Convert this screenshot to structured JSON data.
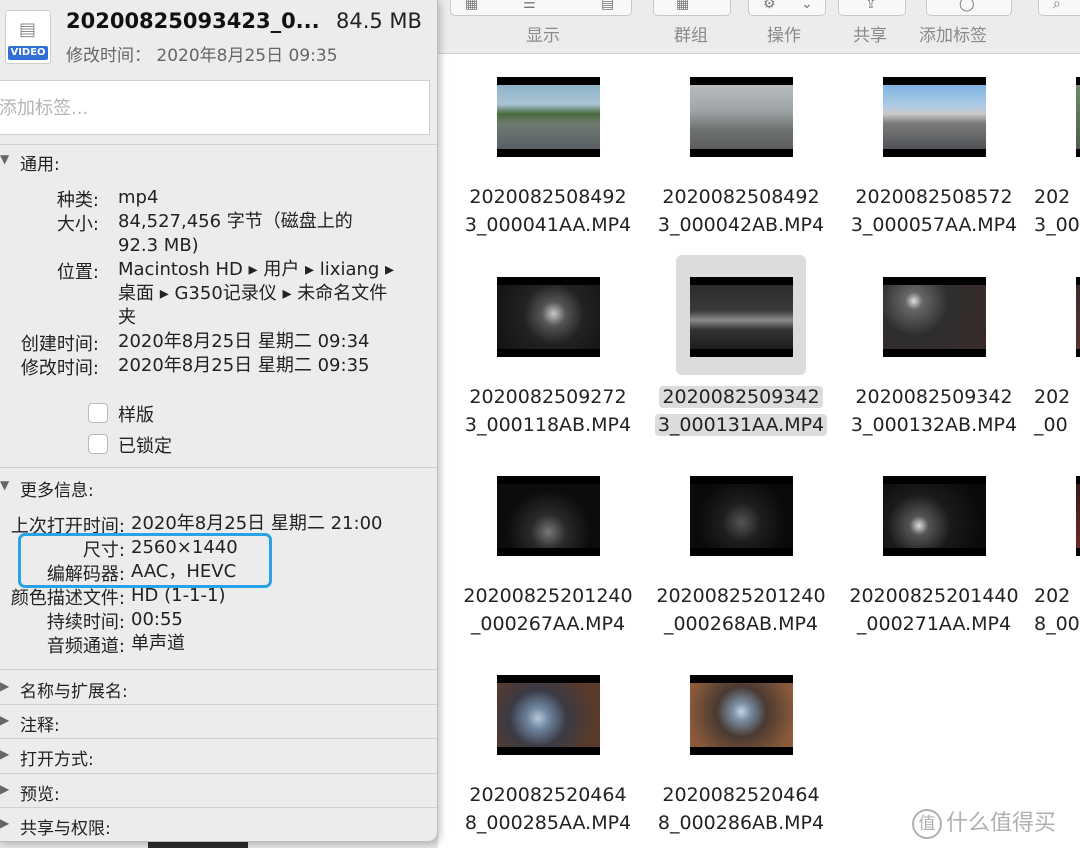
{
  "info_panel": {
    "file_icon_tag": "VIDEO",
    "title": "20200825093423_0...",
    "size": "84.5 MB",
    "modified": "修改时间： 2020年8月25日 09:35",
    "tags_placeholder": "添加标签...",
    "general": {
      "header": "通用:",
      "kind_label": "种类:",
      "kind": "mp4",
      "size_label": "大小:",
      "size_line1": "84,527,456 字节（磁盘上的",
      "size_line2": "92.3 MB)",
      "where_label": "位置:",
      "where_line1": "Macintosh HD ▸ 用户 ▸ lixiang ▸",
      "where_line2": "桌面 ▸ G350记录仪 ▸ 未命名文件",
      "where_line3": "夹",
      "created_label": "创建时间:",
      "created": "2020年8月25日 星期二 09:34",
      "modified_label": "修改时间:",
      "modified": "2020年8月25日 星期二 09:35",
      "stationery_label": "样版",
      "locked_label": "已锁定"
    },
    "more_info": {
      "header": "更多信息:",
      "last_opened_label": "上次打开时间:",
      "last_opened": "2020年8月25日 星期二 21:00",
      "dimensions_label": "尺寸:",
      "dimensions": "2560×1440",
      "codecs_label": "编解码器:",
      "codecs": "AAC，HEVC",
      "color_profile_label": "颜色描述文件:",
      "color_profile": "HD (1-1-1)",
      "duration_label": "持续时间:",
      "duration": "00:55",
      "audio_channels_label": "音频通道:",
      "audio_channels": "单声道"
    },
    "collapsed_sections": [
      "名称与扩展名:",
      "注释:",
      "打开方式:",
      "预览:",
      "共享与权限:"
    ]
  },
  "toolbar": {
    "view_label": "显示",
    "group_label": "群组",
    "action_label": "操作",
    "share_label": "共享",
    "tags_label": "添加标签"
  },
  "files": [
    {
      "line1": "2020082508492",
      "line2": "3_000041AA.MP4",
      "selected": false
    },
    {
      "line1": "2020082508492",
      "line2": "3_000042AB.MP4",
      "selected": false
    },
    {
      "line1": "2020082508572",
      "line2": "3_000057AA.MP4",
      "selected": false
    },
    {
      "line1": "202",
      "line2": "3_00",
      "selected": false
    },
    {
      "line1": "2020082509272",
      "line2": "3_000118AB.MP4",
      "selected": false
    },
    {
      "line1": "2020082509342",
      "line2": "3_000131AA.MP4",
      "selected": true
    },
    {
      "line1": "2020082509342",
      "line2": "3_000132AB.MP4",
      "selected": false
    },
    {
      "line1": "202",
      "line2": "_00",
      "selected": false
    },
    {
      "line1": "20200825201240",
      "line2": "_000267AA.MP4",
      "selected": false
    },
    {
      "line1": "20200825201240",
      "line2": "_000268AB.MP4",
      "selected": false
    },
    {
      "line1": "20200825201440",
      "line2": "_000271AA.MP4",
      "selected": false
    },
    {
      "line1": "202",
      "line2": "8_00",
      "selected": false
    },
    {
      "line1": "2020082520464",
      "line2": "8_000285AA.MP4",
      "selected": false
    },
    {
      "line1": "2020082520464",
      "line2": "8_000286AB.MP4",
      "selected": false
    }
  ],
  "watermark": {
    "logo": "值",
    "text": "什么值得买"
  },
  "colors": {
    "highlight": "#29a3e6",
    "selection": "#dcdcdc",
    "video_tag": "#2f6fd6"
  }
}
